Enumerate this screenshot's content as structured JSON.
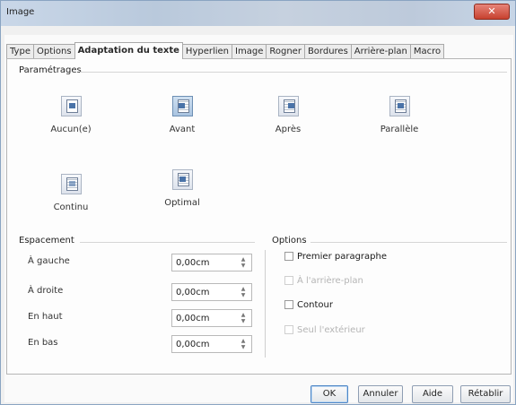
{
  "window": {
    "title": "Image",
    "close_symbol": "✕"
  },
  "tabs": [
    {
      "label": "Type",
      "active": false
    },
    {
      "label": "Options",
      "active": false
    },
    {
      "label": "Adaptation du texte",
      "active": true
    },
    {
      "label": "Hyperlien",
      "active": false
    },
    {
      "label": "Image",
      "active": false
    },
    {
      "label": "Rogner",
      "active": false
    },
    {
      "label": "Bordures",
      "active": false
    },
    {
      "label": "Arrière-plan",
      "active": false
    },
    {
      "label": "Macro",
      "active": false
    }
  ],
  "parametrages": {
    "header": "Paramétrages",
    "options": [
      {
        "label": "Aucun(e)",
        "icon": "wrap-none-icon",
        "selected": false
      },
      {
        "label": "Avant",
        "icon": "wrap-before-icon",
        "selected": true
      },
      {
        "label": "Après",
        "icon": "wrap-after-icon",
        "selected": false
      },
      {
        "label": "Parallèle",
        "icon": "wrap-parallel-icon",
        "selected": false
      },
      {
        "label": "Continu",
        "icon": "wrap-through-icon",
        "selected": false
      },
      {
        "label": "Optimal",
        "icon": "wrap-optimal-icon",
        "selected": false
      }
    ]
  },
  "espacement": {
    "header": "Espacement",
    "rows": [
      {
        "label": "À gauche",
        "value": "0,00cm"
      },
      {
        "label": "À droite",
        "value": "0,00cm"
      },
      {
        "label": "En haut",
        "value": "0,00cm"
      },
      {
        "label": "En bas",
        "value": "0,00cm"
      }
    ]
  },
  "options": {
    "header": "Options",
    "items": [
      {
        "label": "Premier paragraphe",
        "enabled": true,
        "checked": false
      },
      {
        "label": "À l'arrière-plan",
        "enabled": false,
        "checked": false
      },
      {
        "label": "Contour",
        "enabled": true,
        "checked": false
      },
      {
        "label": "Seul l'extérieur",
        "enabled": false,
        "checked": false
      }
    ]
  },
  "buttons": {
    "ok": "OK",
    "cancel": "Annuler",
    "help": "Aide",
    "reset": "Rétablir"
  }
}
